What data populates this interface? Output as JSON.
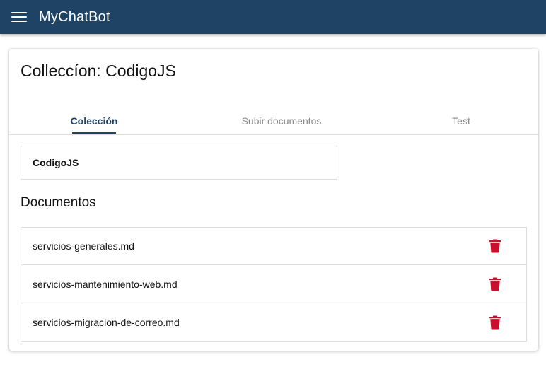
{
  "app": {
    "title": "MyChatBot"
  },
  "card": {
    "title": "Colleccíon: CodigoJS"
  },
  "tabs": [
    {
      "label": "Colección",
      "active": true
    },
    {
      "label": "Subir documentos",
      "active": false
    },
    {
      "label": "Test",
      "active": false
    }
  ],
  "collection": {
    "name": "CodigoJS"
  },
  "documents": {
    "heading": "Documentos",
    "items": [
      {
        "name": "servicios-generales.md"
      },
      {
        "name": "servicios-mantenimiento-web.md"
      },
      {
        "name": "servicios-migracion-de-correo.md"
      }
    ]
  },
  "colors": {
    "appbar": "#1e4364",
    "accent": "#1e4364",
    "delete": "#c8102e"
  },
  "icons": {
    "menu": "menu-icon",
    "delete": "trash-icon"
  }
}
